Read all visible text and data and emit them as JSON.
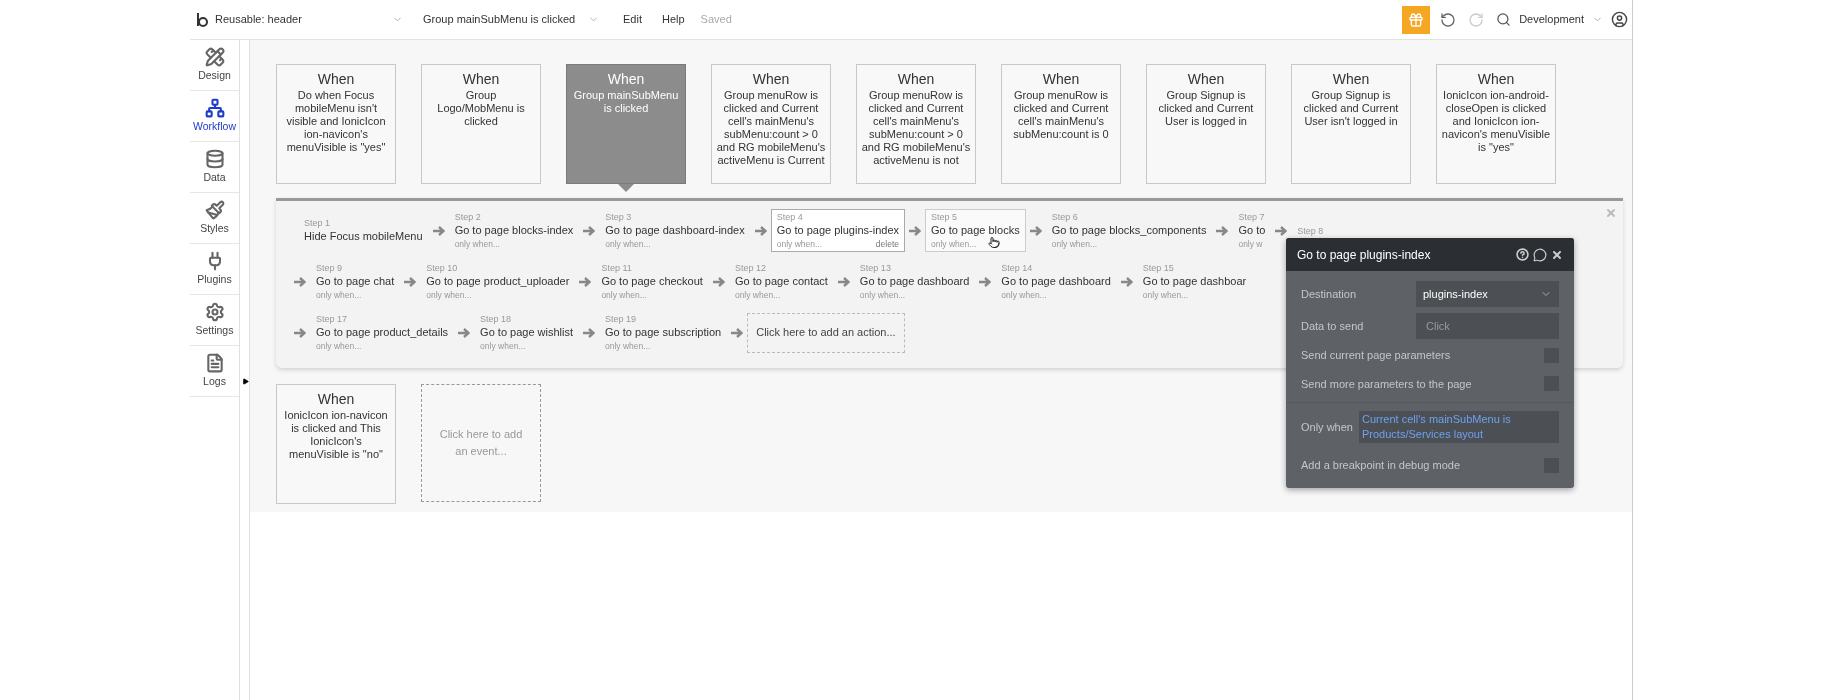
{
  "topbar": {
    "page_selector": "Reusable: header",
    "event_selector": "Group mainSubMenu is clicked",
    "menu": [
      "Edit",
      "Help"
    ],
    "save_status": "Saved",
    "environment": "Development"
  },
  "sidebar": {
    "items": [
      {
        "kind": "design",
        "label": "Design",
        "selected": false
      },
      {
        "kind": "workflow",
        "label": "Workflow",
        "selected": true
      },
      {
        "kind": "data",
        "label": "Data",
        "selected": false
      },
      {
        "kind": "styles",
        "label": "Styles",
        "selected": false
      },
      {
        "kind": "plugins",
        "label": "Plugins",
        "selected": false
      },
      {
        "kind": "settings",
        "label": "Settings",
        "selected": false
      },
      {
        "kind": "logs",
        "label": "Logs",
        "selected": false
      }
    ]
  },
  "events": [
    {
      "kind": "event",
      "heading": "When",
      "text": "Do when Focus mobileMenu isn't visible and IonicIcon ion-navicon's menuVisible is \"yes\"",
      "selected": false
    },
    {
      "kind": "event",
      "heading": "When",
      "text": "Group Logo/MobMenu is clicked",
      "selected": false
    },
    {
      "kind": "event",
      "heading": "When",
      "text": "Group mainSubMenu is clicked",
      "selected": true
    },
    {
      "kind": "event",
      "heading": "When",
      "text": "Group menuRow is clicked and Current cell's mainMenu's subMenu:count > 0 and RG mobileMenu's activeMenu is Current",
      "selected": false
    },
    {
      "kind": "event",
      "heading": "When",
      "text": "Group menuRow is clicked and Current cell's mainMenu's subMenu:count > 0 and RG mobileMenu's activeMenu is not",
      "selected": false
    },
    {
      "kind": "event",
      "heading": "When",
      "text": "Group menuRow is clicked and Current cell's mainMenu's subMenu:count is 0",
      "selected": false
    },
    {
      "kind": "event",
      "heading": "When",
      "text": "Group Signup is clicked and Current User is logged in",
      "selected": false
    },
    {
      "kind": "event",
      "heading": "When",
      "text": "Group Signup is clicked and Current User isn't logged in",
      "selected": false
    },
    {
      "kind": "event",
      "heading": "When",
      "text": "IonicIcon ion-android-closeOpen is clicked and IonicIcon ion-navicon's menuVisible is \"yes\"",
      "selected": false
    }
  ],
  "steps_rows": [
    [
      {
        "kind": "step",
        "label": "Step 1",
        "title": "Hide Focus mobileMenu",
        "selected": false,
        "hovered": false
      },
      {
        "kind": "step",
        "label": "Step 2",
        "title": "Go to page blocks-index",
        "only_when": "only when...",
        "selected": false,
        "hovered": false
      },
      {
        "kind": "step",
        "label": "Step 3",
        "title": "Go to page dashboard-index",
        "only_when": "only when...",
        "selected": false,
        "hovered": false
      },
      {
        "kind": "step",
        "label": "Step 4",
        "title": "Go to page plugins-index",
        "only_when": "only when...",
        "delete": "delete",
        "selected": true,
        "hovered": false
      },
      {
        "kind": "step",
        "label": "Step 5",
        "title": "Go to page blocks",
        "only_when": "only when...",
        "selected": false,
        "hovered": true
      },
      {
        "kind": "step",
        "label": "Step 6",
        "title": "Go to page blocks_components",
        "only_when": "only when...",
        "selected": false,
        "hovered": false
      },
      {
        "kind": "step",
        "label": "Step 7",
        "title": "Go to",
        "only_when": "only w",
        "selected": false,
        "hovered": false
      },
      {
        "kind": "step",
        "label": "Step 8",
        "selected": false,
        "hovered": false
      }
    ],
    [
      {
        "kind": "step",
        "label": "Step 9",
        "title": "Go to page chat",
        "only_when": "only when...",
        "selected": false,
        "hovered": false
      },
      {
        "kind": "step",
        "label": "Step 10",
        "title": "Go to page product_uploader",
        "only_when": "only when...",
        "selected": false,
        "hovered": false
      },
      {
        "kind": "step",
        "label": "Step 11",
        "title": "Go to page checkout",
        "only_when": "only when...",
        "selected": false,
        "hovered": false
      },
      {
        "kind": "step",
        "label": "Step 12",
        "title": "Go to page contact",
        "only_when": "only when...",
        "selected": false,
        "hovered": false
      },
      {
        "kind": "step",
        "label": "Step 13",
        "title": "Go to page dashboard",
        "only_when": "only when...",
        "selected": false,
        "hovered": false
      },
      {
        "kind": "step",
        "label": "Step 14",
        "title": "Go to page dashboard",
        "only_when": "only when...",
        "selected": false,
        "hovered": false
      },
      {
        "kind": "step",
        "label": "Step 15",
        "title": "Go to page dashboar",
        "only_when": "only when...",
        "selected": false,
        "hovered": false
      }
    ],
    [
      {
        "kind": "step",
        "label": "Step 17",
        "title": "Go to page product_details",
        "only_when": "only when...",
        "selected": false,
        "hovered": false
      },
      {
        "kind": "step",
        "label": "Step 18",
        "title": "Go to page wishlist",
        "only_when": "only when...",
        "selected": false,
        "hovered": false
      },
      {
        "kind": "step",
        "label": "Step 19",
        "title": "Go to page subscription",
        "only_when": "only when...",
        "selected": false,
        "hovered": false
      },
      {
        "kind": "add",
        "label": "Click here to add an action..."
      }
    ]
  ],
  "events_row_2": [
    {
      "kind": "event",
      "heading": "When",
      "text": "IonicIcon ion-navicon is clicked and This IonicIcon's menuVisible is \"no\"",
      "selected": false
    },
    {
      "kind": "add",
      "label": "Click here to add an event..."
    }
  ],
  "popup": {
    "title": "Go to page plugins-index",
    "fields": [
      {
        "kind": "dropdown",
        "label": "Destination",
        "value": "plugins-index"
      },
      {
        "kind": "input",
        "label": "Data to send",
        "placeholder": "Click"
      },
      {
        "kind": "checkbox",
        "label": "Send current page parameters",
        "checked": false
      },
      {
        "kind": "checkbox",
        "label": "Send more parameters to the page",
        "checked": false
      },
      {
        "kind": "condition",
        "label": "Only when",
        "value": "Current cell's mainSubMenu is Products/Services layout"
      },
      {
        "kind": "checkbox",
        "label": "Add a breakpoint in debug mode",
        "checked": false
      }
    ]
  }
}
